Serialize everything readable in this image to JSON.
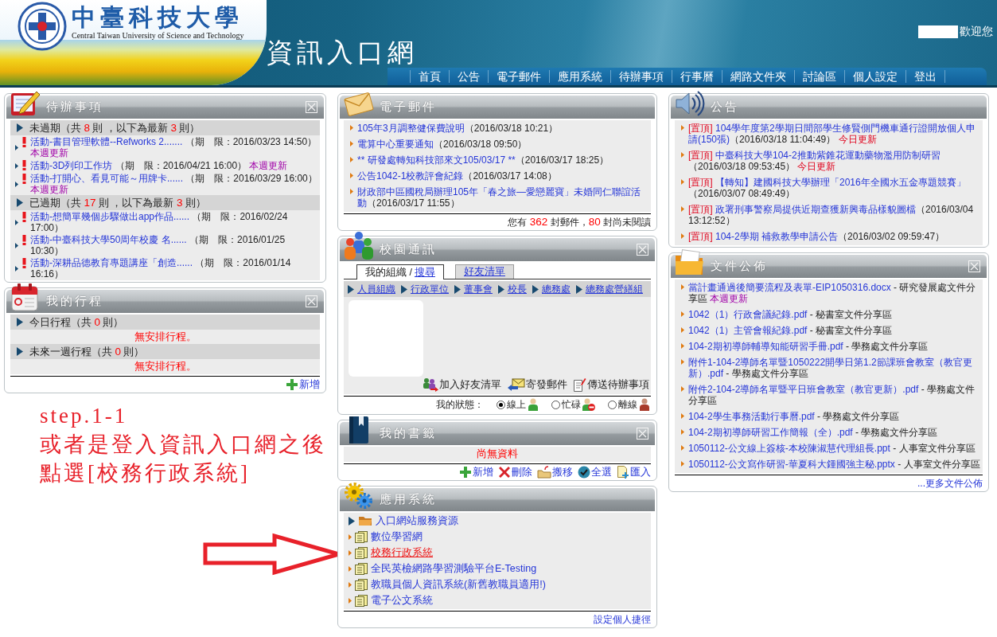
{
  "header": {
    "school_name": "中臺科技大學",
    "school_name_en": "Central Taiwan University of Science and Technology",
    "site_title": "資訊入口網",
    "welcome": "歡迎您",
    "nav": [
      "首頁",
      "公告",
      "電子郵件",
      "應用系統",
      "待辦事項",
      "行事曆",
      "網路文件夾",
      "討論區",
      "個人設定",
      "登出"
    ]
  },
  "todo": {
    "title": "待辦事項",
    "closable": true,
    "sections": [
      {
        "segments": [
          {
            "text": "未過期（共 ",
            "kind": "plain"
          },
          {
            "text": "8",
            "kind": "count"
          },
          {
            "text": " 則 ，以下為最新 ",
            "kind": "plain"
          },
          {
            "text": "3",
            "kind": "count"
          },
          {
            "text": " 則）",
            "kind": "plain"
          }
        ],
        "items": [
          {
            "title": "活動-書目管理軟體--Refworks 2.......",
            "deadline": "（期　限：2016/03/23 14:50）",
            "badge": "本週更新"
          },
          {
            "title": "活動-3D列印工作坊",
            "deadline": "（期　限：2016/04/21 16:00）",
            "badge": "本週更新"
          },
          {
            "title": "活動-打開心、看見可能～用牌卡......",
            "deadline": "（期　限：2016/03/29 16:00）",
            "badge": "本週更新"
          }
        ]
      },
      {
        "segments": [
          {
            "text": "已過期（共 ",
            "kind": "plain"
          },
          {
            "text": "17",
            "kind": "count"
          },
          {
            "text": " 則 ，以下為最新 ",
            "kind": "plain"
          },
          {
            "text": "3",
            "kind": "count"
          },
          {
            "text": " 則）",
            "kind": "plain"
          }
        ],
        "items": [
          {
            "title": "活動-想簡單幾個步驟做出app作品......",
            "deadline": "（期　限：2016/02/24 17:00）"
          },
          {
            "title": "活動-中臺科技大學50周年校慶 名......",
            "deadline": "（期　限：2016/01/25 10:30）"
          },
          {
            "title": "活動-深耕品德教育專題講座「創造......",
            "deadline": "（期　限：2016/01/14 16:16）"
          }
        ]
      }
    ]
  },
  "schedule": {
    "title": "我的行程",
    "closable": true,
    "sections": [
      {
        "segments": [
          {
            "text": "今日行程（共 ",
            "kind": "plain"
          },
          {
            "text": "0",
            "kind": "count"
          },
          {
            "text": " 則）",
            "kind": "plain"
          }
        ],
        "empty_text": "無安排行程。"
      },
      {
        "segments": [
          {
            "text": "未來一週行程（共 ",
            "kind": "plain"
          },
          {
            "text": "0",
            "kind": "count"
          },
          {
            "text": " 則）",
            "kind": "plain"
          }
        ],
        "empty_text": "無安排行程。"
      }
    ],
    "actions": [
      {
        "label": "新增",
        "kind": "add"
      }
    ]
  },
  "annotation": {
    "lines": [
      "step.1-1",
      "或者是登入資訊入口網之後",
      "點選[校務行政系統]"
    ]
  },
  "email": {
    "title": "電子郵件",
    "closable": false,
    "items": [
      {
        "subject": "105年3月調整健保費說明",
        "date": "（2016/03/18 10:21）"
      },
      {
        "subject": "電算中心重要通知",
        "date": "（2016/03/18 09:50）"
      },
      {
        "subject": "** 研發處轉知科技部來文105/03/17 **",
        "date": "（2016/03/17 18:25）"
      },
      {
        "subject": "公告1042-1校教評會紀錄",
        "date": "（2016/03/17 14:08）"
      },
      {
        "subject": "財政部中區國稅局辦理105年「春之旅—愛戀麗寶」未婚同仁聯誼活動",
        "date": "（2016/03/17 11:55）"
      }
    ],
    "summary": [
      {
        "text": "您有 ",
        "kind": "plain"
      },
      {
        "text": "362",
        "kind": "count"
      },
      {
        "text": " 封郵件，",
        "kind": "plain"
      },
      {
        "text": "80",
        "kind": "count"
      },
      {
        "text": " 封尚未閱讀",
        "kind": "plain"
      }
    ]
  },
  "campus": {
    "title": "校園通訊",
    "closable": true,
    "tabs": [
      {
        "label": "我的組織 /",
        "link": "搜尋",
        "selected": true
      },
      {
        "label": "好友清單",
        "selected": false
      }
    ],
    "breadcrumb": [
      "人員組織",
      "行政單位",
      "董事會",
      "校長",
      "總務處",
      "總務處營繕組"
    ],
    "actions": [
      {
        "label": "加入好友清單",
        "kind": "add-friend"
      },
      {
        "label": "寄發郵件",
        "kind": "send-mail"
      },
      {
        "label": "傳送待辦事項",
        "kind": "send-todo"
      }
    ],
    "status_label": "我的狀態：",
    "statuses": [
      {
        "label": "線上",
        "kind": "online",
        "selected": true
      },
      {
        "label": "忙碌",
        "kind": "busy",
        "selected": false
      },
      {
        "label": "離線",
        "kind": "offline",
        "selected": false
      }
    ]
  },
  "bookmarks": {
    "title": "我的書籤",
    "closable": true,
    "empty_text": "尚無資料",
    "actions": [
      {
        "label": "新增",
        "kind": "add"
      },
      {
        "label": "刪除",
        "kind": "delete"
      },
      {
        "label": "搬移",
        "kind": "move"
      },
      {
        "label": "全選",
        "kind": "select-all"
      },
      {
        "label": "匯入",
        "kind": "import"
      }
    ]
  },
  "apps": {
    "title": "應用系統",
    "closable": false,
    "items": [
      {
        "label": "入口網站服務資源",
        "kind": "folder",
        "highlighted": false
      },
      {
        "label": "數位學習網",
        "kind": "system",
        "highlighted": false
      },
      {
        "label": "校務行政系統",
        "kind": "system",
        "highlighted": true
      },
      {
        "label": "全民英檢網路學習測驗平台E-Testing",
        "kind": "system",
        "highlighted": false
      },
      {
        "label": "教職員個人資訊系統(新舊教職員適用!)",
        "kind": "system",
        "highlighted": false
      },
      {
        "label": "電子公文系統",
        "kind": "system",
        "highlighted": false
      }
    ],
    "footer_link": "設定個人捷徑"
  },
  "announcements": {
    "title": "公告",
    "closable": false,
    "items": [
      {
        "tag": "[置頂]",
        "title": "104學年度第2學期日間部學生修賢側門機車通行證開放個人申請(150張)",
        "date": "（2016/03/18 11:04:49）",
        "badge": "今日更新"
      },
      {
        "tag": "[置頂]",
        "title": "中臺科技大學104-2推動紫錐花運動藥物濫用防制研習",
        "date": "（2016/03/18 09:53:45）",
        "badge": "今日更新"
      },
      {
        "tag": "[置頂]",
        "title": "【轉知】建國科技大學辦理「2016年全國水五金專題競賽」",
        "date": "（2016/03/07 08:49:49）"
      },
      {
        "tag": "[置頂]",
        "title": "政署刑事警察局提供近期查獲新興毒品樣貌圖檔",
        "date": "（2016/03/04 13:12:52）"
      },
      {
        "tag": "[置頂]",
        "title": "104-2學期 補救教學申請公告",
        "date": "（2016/03/02 09:59:47）"
      }
    ]
  },
  "documents": {
    "title": "文件公佈",
    "closable": true,
    "items": [
      {
        "name": "當計畫通過後簡要流程及表單-EIP1050316.docx",
        "source": "- 研究發展處文件分享區",
        "badge": "本週更新"
      },
      {
        "name": "1042（1）行政會議紀錄.pdf",
        "source": "- 秘書室文件分享區"
      },
      {
        "name": "1042（1）主管會報紀錄.pdf",
        "source": "- 秘書室文件分享區"
      },
      {
        "name": "104-2期初導師輔導知能研習手冊.pdf",
        "source": "- 學務處文件分享區"
      },
      {
        "name": "附件1-104-2導師名單暨1050222開學日第1.2節課班會教室（教官更新）.pdf",
        "source": "- 學務處文件分享區"
      },
      {
        "name": "附件2-104-2導師名單暨平日班會教室（教官更新）.pdf",
        "source": "- 學務處文件分享區"
      },
      {
        "name": "104-2學生事務活動行事曆.pdf",
        "source": "- 學務處文件分享區"
      },
      {
        "name": "104-2期初導師研習工作簡報（全）.pdf",
        "source": "- 學務處文件分享區"
      },
      {
        "name": "1050112-公文線上簽核-本校陳淑慧代理組長.ppt",
        "source": "- 人事室文件分享區"
      },
      {
        "name": "1050112-公文寫作研習-華夏科大鍾國強主秘.pptx",
        "source": "- 人事室文件分享區"
      }
    ],
    "more_link": "...更多文件公佈"
  }
}
